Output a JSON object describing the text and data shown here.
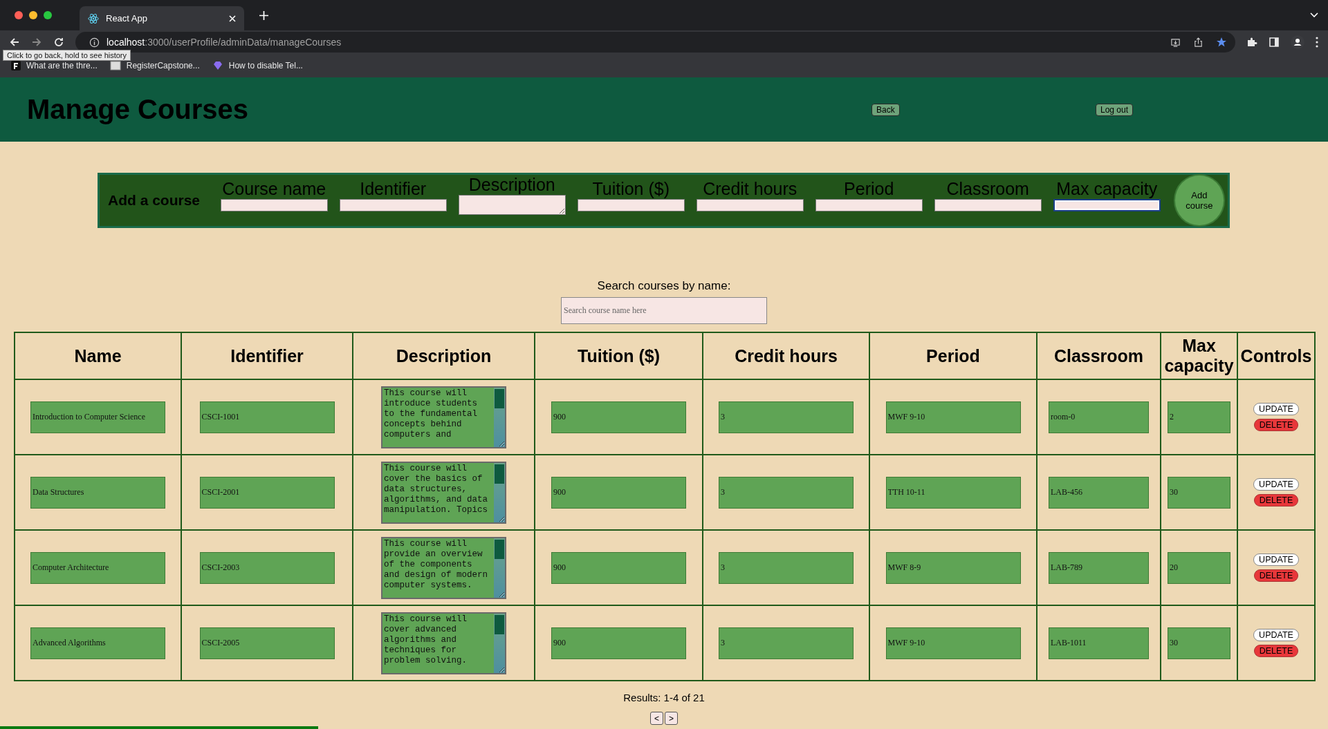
{
  "browser": {
    "tab_title": "React App",
    "url_host": "localhost",
    "url_path": ":3000/userProfile/adminData/manageCourses",
    "tooltip": "Click to go back, hold to see history",
    "bookmarks": [
      "What are the thre...",
      "RegisterCapstone...",
      "How to disable Tel..."
    ]
  },
  "header": {
    "title": "Manage Courses",
    "buttons": [
      "Back",
      "Log out"
    ]
  },
  "add_form": {
    "title": "Add a course",
    "button": "Add course",
    "fields": [
      {
        "label": "Course name",
        "kind": "input",
        "focused": false
      },
      {
        "label": "Identifier",
        "kind": "input",
        "focused": false
      },
      {
        "label": "Description",
        "kind": "textarea",
        "focused": false
      },
      {
        "label": "Tuition ($)",
        "kind": "input",
        "focused": false
      },
      {
        "label": "Credit hours",
        "kind": "input",
        "focused": false
      },
      {
        "label": "Period",
        "kind": "input",
        "focused": false
      },
      {
        "label": "Classroom",
        "kind": "input",
        "focused": false
      },
      {
        "label": "Max capacity",
        "kind": "input",
        "focused": true
      }
    ]
  },
  "search": {
    "label": "Search courses by name:",
    "placeholder": "Search course name here"
  },
  "table": {
    "columns": [
      "Name",
      "Identifier",
      "Description",
      "Tuition ($)",
      "Credit hours",
      "Period",
      "Classroom",
      "Max capacity",
      "Controls"
    ],
    "rows": [
      {
        "name": "Introduction to Computer Science",
        "identifier": "CSCI-1001",
        "description": "This course will introduce students to the fundamental concepts behind computers and",
        "tuition": "900",
        "credit_hours": "3",
        "period": "MWF 9-10",
        "classroom": "room-0",
        "max_capacity": "2",
        "update": "UPDATE",
        "delete": "DELETE"
      },
      {
        "name": "Data Structures",
        "identifier": "CSCI-2001",
        "description": "This course will cover the basics of data structures, algorithms, and data manipulation. Topics",
        "tuition": "900",
        "credit_hours": "3",
        "period": "TTH 10-11",
        "classroom": "LAB-456",
        "max_capacity": "30",
        "update": "UPDATE",
        "delete": "DELETE"
      },
      {
        "name": "Computer Architecture",
        "identifier": "CSCI-2003",
        "description": "This course will provide an overview of the components and design of modern computer systems.",
        "tuition": "900",
        "credit_hours": "3",
        "period": "MWF 8-9",
        "classroom": "LAB-789",
        "max_capacity": "20",
        "update": "UPDATE",
        "delete": "DELETE"
      },
      {
        "name": "Advanced Algorithms",
        "identifier": "CSCI-2005",
        "description": "This course will cover advanced algorithms and techniques for problem solving.",
        "tuition": "900",
        "credit_hours": "3",
        "period": "MWF 9-10",
        "classroom": "LAB-1011",
        "max_capacity": "30",
        "update": "UPDATE",
        "delete": "DELETE"
      }
    ]
  },
  "results": "Results: 1-4 of 21",
  "pager": [
    "<",
    ">"
  ]
}
